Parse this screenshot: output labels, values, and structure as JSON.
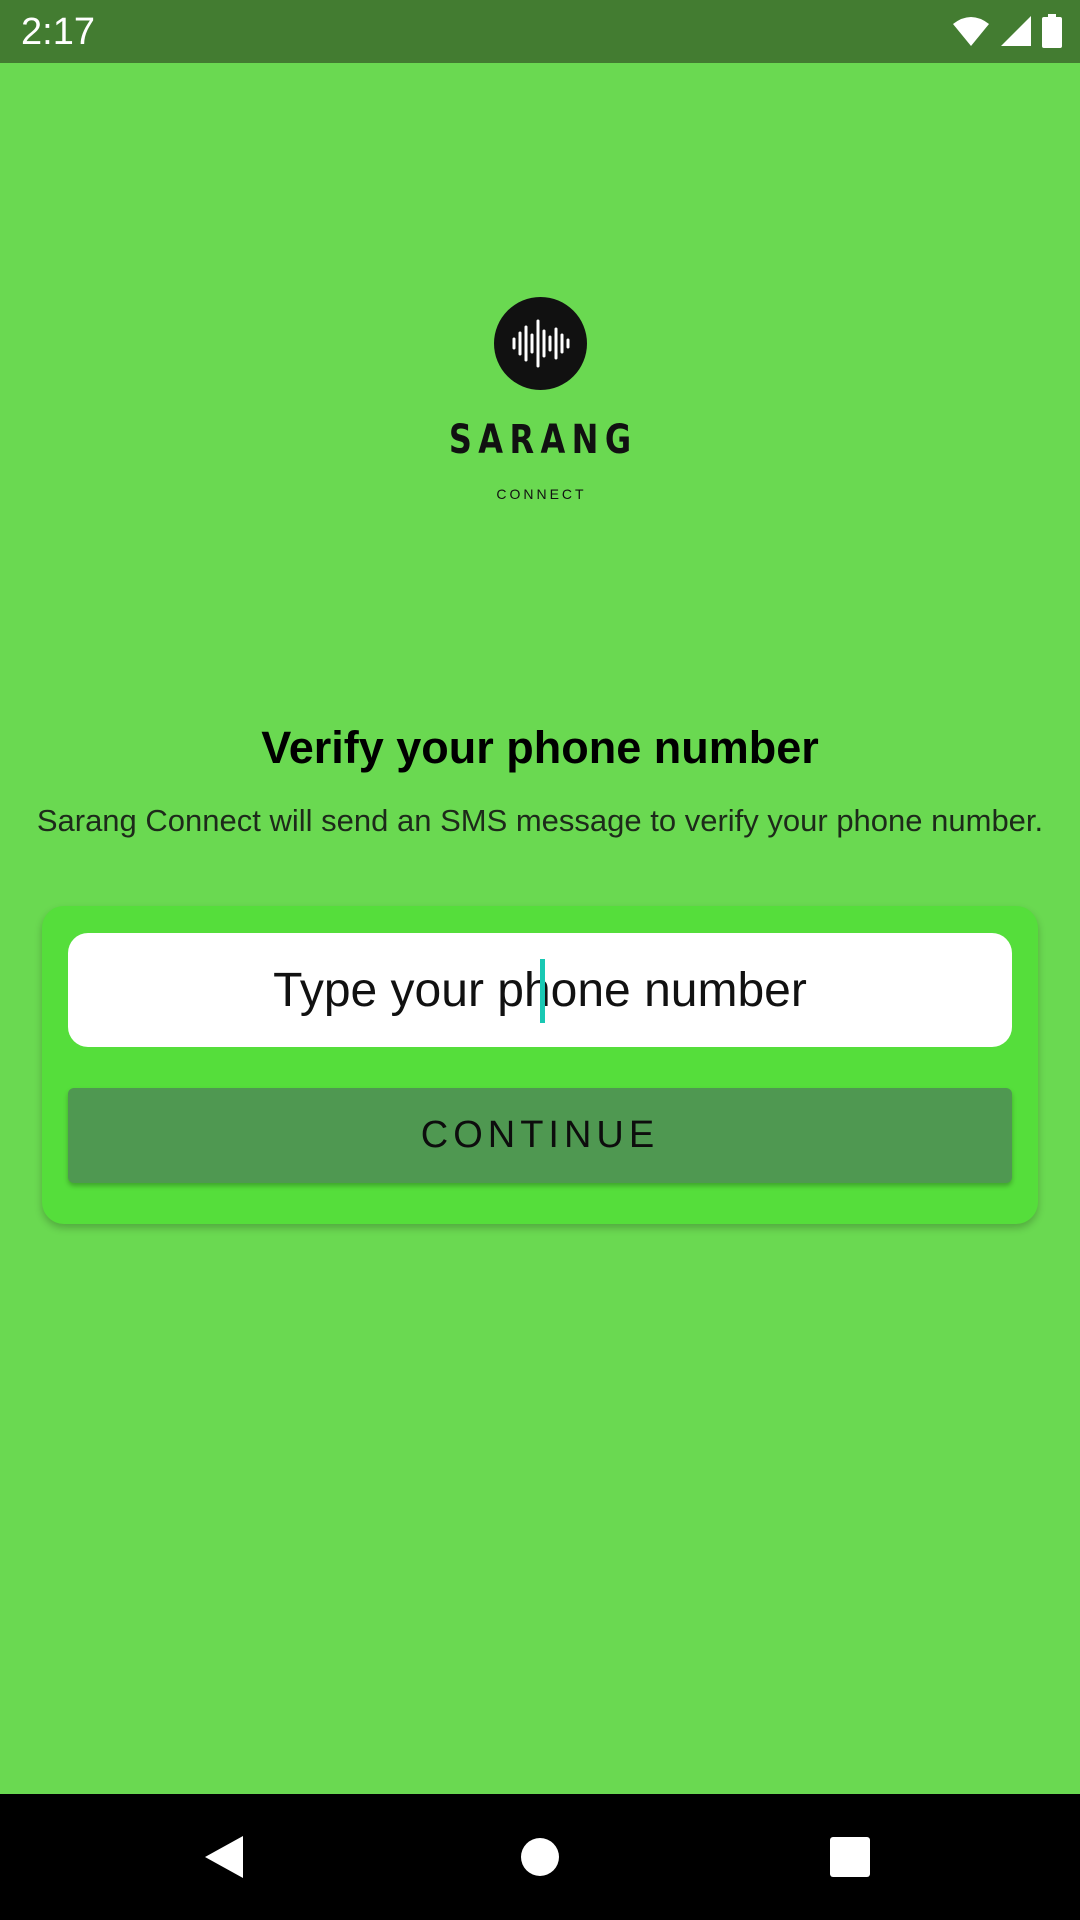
{
  "status_bar": {
    "time": "2:17",
    "icons": [
      "wifi-icon",
      "cell-signal-icon",
      "battery-icon"
    ]
  },
  "logo": {
    "icon": "sound-wave-icon",
    "name": "SARANG",
    "subtitle": "CONNECT"
  },
  "main": {
    "heading": "Verify your phone number",
    "description": "Sarang Connect will send an SMS message to verify your phone number.",
    "phone_input": {
      "value": "",
      "placeholder": "Type your phone number"
    },
    "continue_label": "CONTINUE"
  },
  "nav_bar": {
    "icons": [
      "back-icon",
      "home-icon",
      "recents-icon"
    ]
  },
  "colors": {
    "background": "#6ad951",
    "status_bar": "#437c31",
    "card": "#55de3b",
    "button": "#4f9851",
    "cursor": "#19c8b3"
  }
}
